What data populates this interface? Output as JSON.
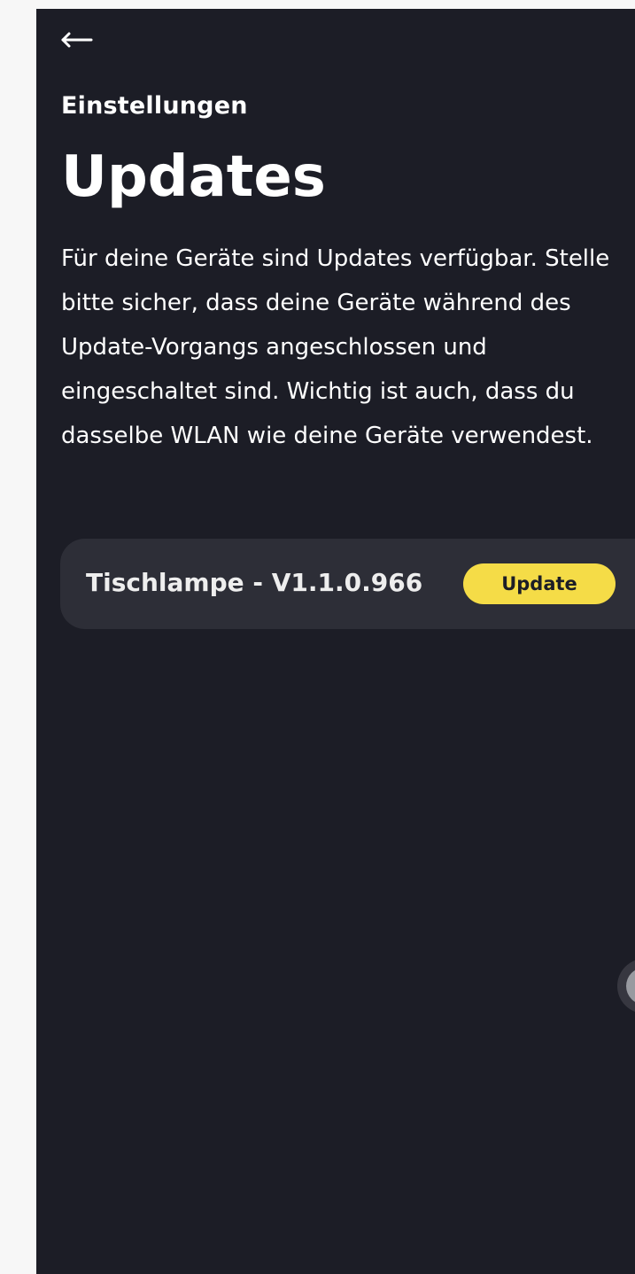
{
  "navigation": {
    "back_icon": "arrow-left-icon"
  },
  "header": {
    "breadcrumb": "Einstellungen",
    "title": "Updates"
  },
  "description": "Für deine Geräte sind Updates verfügbar. Stelle bitte sicher, dass deine Geräte während des Update-Vorgangs angeschlossen und eingeschaltet sind. Wichtig ist auch, dass du dasselbe WLAN wie deine Geräte verwendest.",
  "devices": [
    {
      "label": "Tischlampe  - V1.1.0.966",
      "action_label": "Update"
    }
  ],
  "colors": {
    "background": "#1c1d26",
    "card": "#2d2e37",
    "accent": "#f5dc47",
    "text": "#ffffff"
  }
}
